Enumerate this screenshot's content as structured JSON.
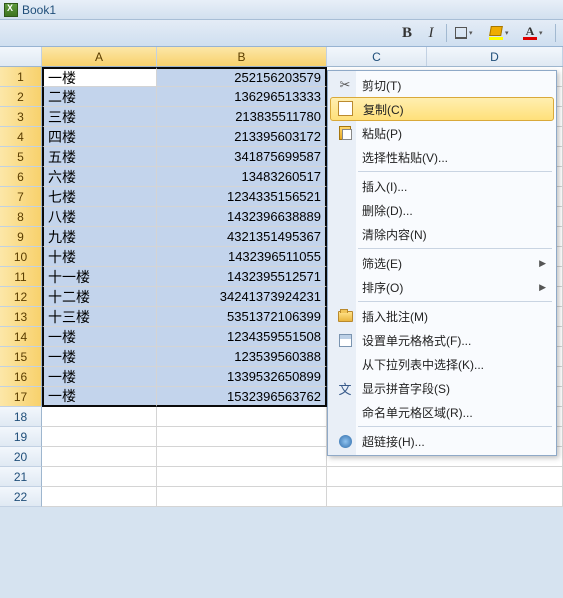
{
  "window": {
    "title": "Book1"
  },
  "toolbar": {
    "bold": "B",
    "italic": "I",
    "font_color_letter": "A"
  },
  "columns": {
    "A": "A",
    "B": "B",
    "C": "C",
    "D": "D"
  },
  "rows": [
    {
      "n": "1",
      "a": "一楼",
      "b": "252156203579"
    },
    {
      "n": "2",
      "a": "二楼",
      "b": "136296513333"
    },
    {
      "n": "3",
      "a": "三楼",
      "b": "213835511780"
    },
    {
      "n": "4",
      "a": "四楼",
      "b": "213395603172"
    },
    {
      "n": "5",
      "a": "五楼",
      "b": "341875699587"
    },
    {
      "n": "6",
      "a": "六楼",
      "b": "13483260517"
    },
    {
      "n": "7",
      "a": "七楼",
      "b": "1234335156521"
    },
    {
      "n": "8",
      "a": "八楼",
      "b": "1432396638889"
    },
    {
      "n": "9",
      "a": "九楼",
      "b": "4321351495367"
    },
    {
      "n": "10",
      "a": "十楼",
      "b": "1432396511055"
    },
    {
      "n": "11",
      "a": "十一楼",
      "b": "1432395512571"
    },
    {
      "n": "12",
      "a": "十二楼",
      "b": "34241373924231"
    },
    {
      "n": "13",
      "a": "十三楼",
      "b": "5351372106399"
    },
    {
      "n": "14",
      "a": "一楼",
      "b": "1234359551508"
    },
    {
      "n": "15",
      "a": "一楼",
      "b": "123539560388"
    },
    {
      "n": "16",
      "a": "一楼",
      "b": "1339532650899"
    },
    {
      "n": "17",
      "a": "一楼",
      "b": "1532396563762"
    },
    {
      "n": "18",
      "a": "",
      "b": ""
    },
    {
      "n": "19",
      "a": "",
      "b": ""
    },
    {
      "n": "20",
      "a": "",
      "b": ""
    },
    {
      "n": "21",
      "a": "",
      "b": ""
    },
    {
      "n": "22",
      "a": "",
      "b": ""
    }
  ],
  "menu": {
    "cut": "剪切(T)",
    "copy": "复制(C)",
    "paste": "粘贴(P)",
    "paste_special": "选择性粘贴(V)...",
    "insert": "插入(I)...",
    "delete": "删除(D)...",
    "clear": "清除内容(N)",
    "filter": "筛选(E)",
    "sort": "排序(O)",
    "insert_comment": "插入批注(M)",
    "format_cells": "设置单元格格式(F)...",
    "pick_from_list": "从下拉列表中选择(K)...",
    "show_pinyin": "显示拼音字段(S)",
    "name_range": "命名单元格区域(R)...",
    "hyperlink": "超链接(H)..."
  }
}
